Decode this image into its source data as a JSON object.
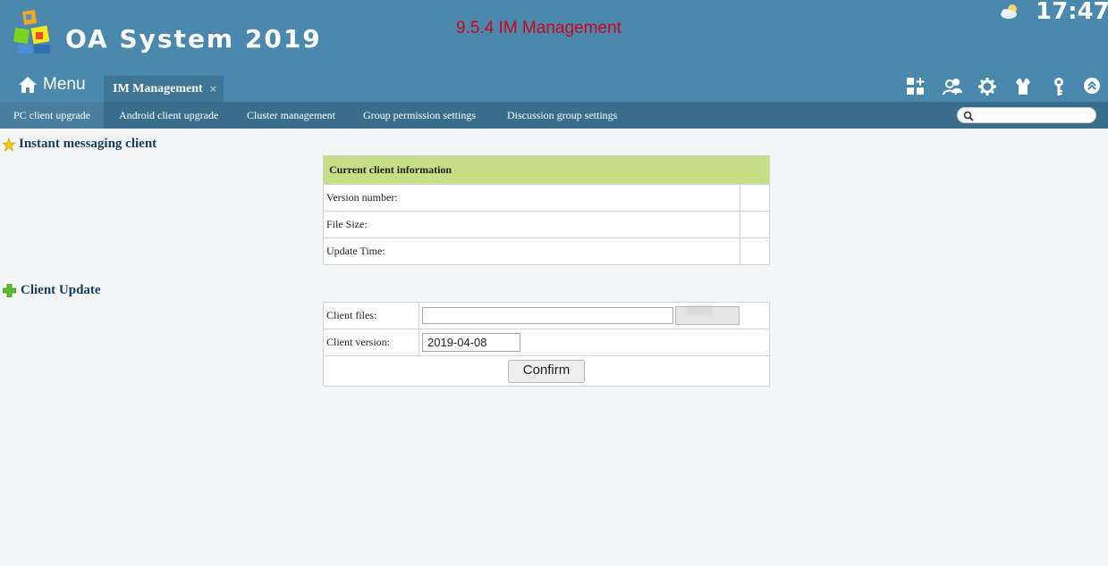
{
  "header": {
    "app_title": "OA System 2019",
    "page_caption": "9.5.4  IM Management",
    "clock": "17:47",
    "weather_icon": "partly-cloudy-icon",
    "menu_label": "Menu",
    "brand_color": "#4a88ad",
    "caption_color": "#d0021b"
  },
  "tabs": [
    {
      "label": "IM Management",
      "close": "×"
    }
  ],
  "toolbar_icons": [
    "apps-add-icon",
    "users-icon",
    "gear-icon",
    "shirt-icon",
    "key-icon",
    "collapse-up-icon"
  ],
  "subnav": {
    "items": [
      {
        "label": "PC client upgrade"
      },
      {
        "label": "Android client upgrade"
      },
      {
        "label": "Cluster management"
      },
      {
        "label": "Group permission settings"
      },
      {
        "label": "Discussion group settings"
      }
    ],
    "active_index": 0,
    "search_placeholder": ""
  },
  "client_info": {
    "section_title": "Instant messaging client",
    "table_header": "Current client information",
    "rows": [
      {
        "label": "Version number:",
        "value": ""
      },
      {
        "label": "File Size:",
        "value": ""
      },
      {
        "label": "Update Time:",
        "value": ""
      }
    ]
  },
  "client_update": {
    "section_title": "Client Update",
    "files_label": "Client files:",
    "files_value": "",
    "version_label": "Client version:",
    "version_value": "2019-04-08",
    "confirm_label": "Confirm"
  }
}
